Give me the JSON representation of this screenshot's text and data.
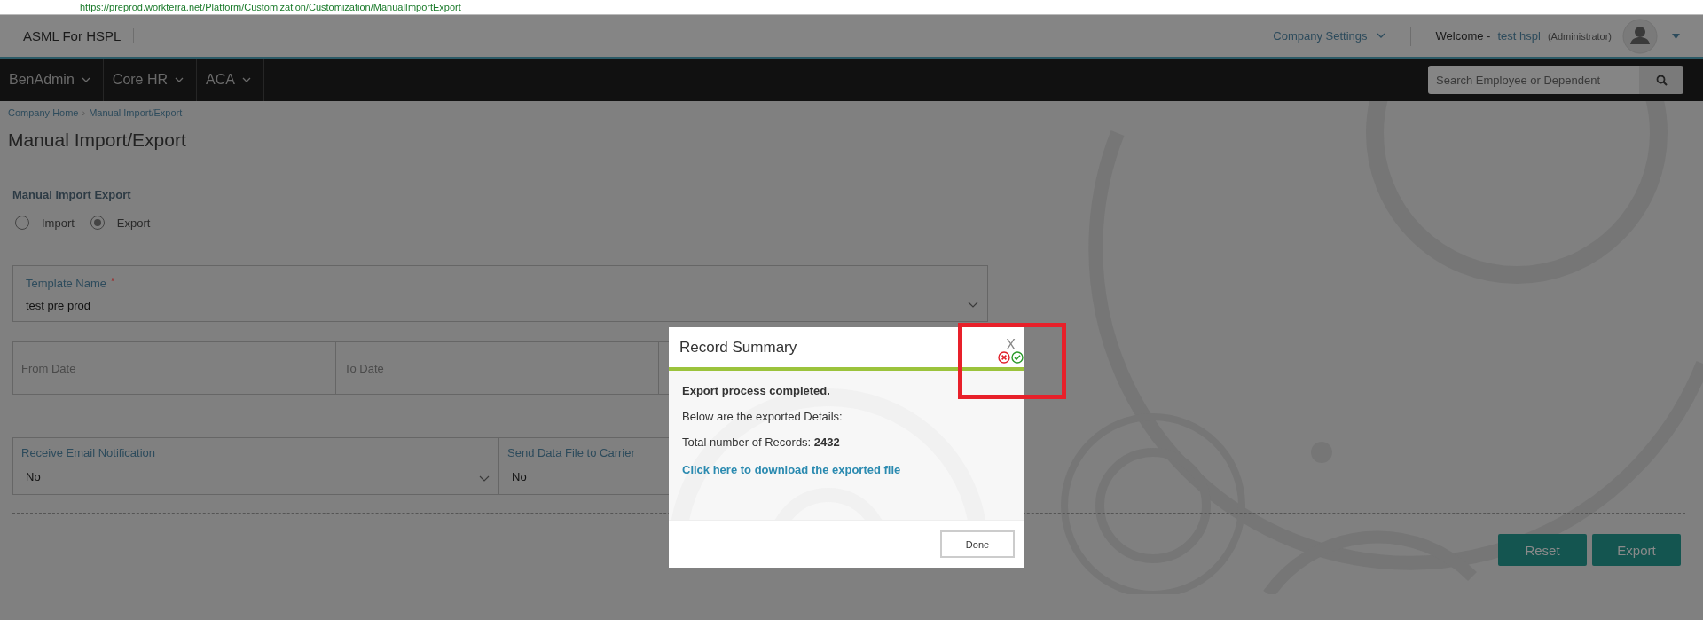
{
  "browser": {
    "url": "https://preprod.workterra.net/Platform/Customization/Customization/ManualImportExport"
  },
  "header": {
    "brand": "ASML For HSPL",
    "company_settings": "Company Settings",
    "welcome": "Welcome -",
    "user": "test hspl",
    "role": "(Administrator)"
  },
  "nav": {
    "items": [
      {
        "label": "BenAdmin"
      },
      {
        "label": "Core HR"
      },
      {
        "label": "ACA"
      }
    ],
    "search": {
      "placeholder": "Search Employee or Dependent"
    }
  },
  "breadcrumb": {
    "separator": "›",
    "items": [
      "Company Home",
      "Manual Import/Export"
    ]
  },
  "page_title": "Manual Import/Export",
  "form": {
    "section_label": "Manual Import Export",
    "options": [
      {
        "label": "Import",
        "selected": false
      },
      {
        "label": "Export",
        "selected": true
      }
    ],
    "template": {
      "label": "Template Name",
      "required_mark": "*",
      "value": "test pre prod"
    },
    "dates": [
      {
        "placeholder": "From Date"
      },
      {
        "placeholder": "To Date"
      }
    ],
    "selects": [
      {
        "label": "Receive Email Notification",
        "value": "No"
      },
      {
        "label": "Send Data File to Carrier",
        "value": "No"
      }
    ],
    "buttons": [
      "Reset",
      "Export"
    ]
  },
  "dialog": {
    "title": "Record Summary",
    "close": "X",
    "status": "Export process completed.",
    "details": "Below are the exported Details:",
    "records_label": "Total number of Records:",
    "records_value": "2432",
    "link": "Click here to download the exported file",
    "button": "Done"
  }
}
